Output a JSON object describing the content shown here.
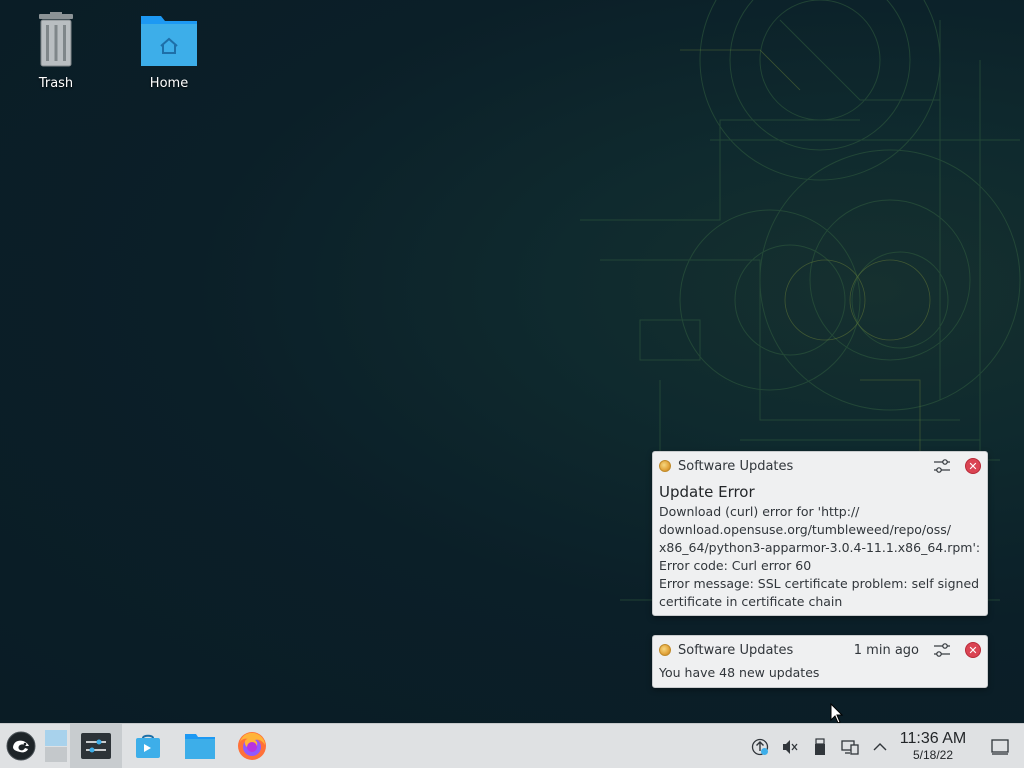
{
  "desktop": {
    "icons": [
      {
        "label": "Trash",
        "icon": "trash-icon"
      },
      {
        "label": "Home",
        "icon": "home-folder-icon"
      }
    ]
  },
  "notifications": [
    {
      "app_name": "Software Updates",
      "time": "",
      "title": "Update Error",
      "body_lines": [
        "Download (curl) error for 'http://",
        "download.opensuse.org/tumbleweed/repo/oss/",
        "x86_64/python3-apparmor-3.0.4-11.1.x86_64.rpm':",
        "Error code: Curl error 60",
        "Error message: SSL certificate problem: self signed",
        "certificate in certificate chain"
      ]
    },
    {
      "app_name": "Software Updates",
      "time": "1 min ago",
      "body": "You have 48 new updates"
    }
  ],
  "taskbar": {
    "launchers": [
      "opensuse-menu-icon",
      "pager-icon",
      "system-settings-icon",
      "discover-icon",
      "dolphin-icon",
      "firefox-icon"
    ],
    "tray": [
      "update-icon",
      "volume-muted-icon",
      "usb-device-icon",
      "network-icon",
      "expand-tray-icon"
    ],
    "clock_time": "11:36 AM",
    "clock_date": "5/18/22"
  },
  "colors": {
    "desktop_bg": "#0b1f28",
    "taskbar_bg": "#dfe1e3",
    "notification_bg": "#eff0f1",
    "close_red": "#da4453",
    "folder_blue": "#3daee9"
  }
}
